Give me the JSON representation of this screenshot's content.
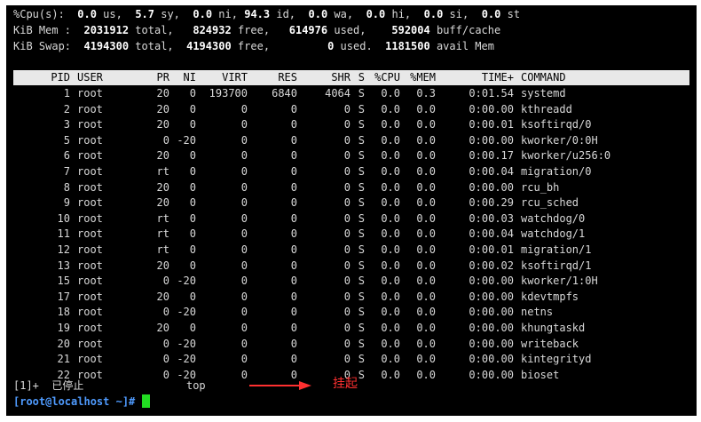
{
  "summary": {
    "cpu": {
      "label": "%Cpu(s):",
      "us": "0.0",
      "us_label": "us,",
      "sy": "5.7",
      "sy_label": "sy,",
      "ni": "0.0",
      "ni_label": "ni,",
      "id": "94.3",
      "id_label": "id,",
      "wa": "0.0",
      "wa_label": "wa,",
      "hi": "0.0",
      "hi_label": "hi,",
      "si": "0.0",
      "si_label": "si,",
      "st": "0.0",
      "st_label": "st"
    },
    "mem": {
      "label": "KiB Mem :",
      "total": "2031912",
      "total_label": "total,",
      "free": "824932",
      "free_label": "free,",
      "used": "614976",
      "used_label": "used,",
      "buff": "592004",
      "buff_label": "buff/cache"
    },
    "swap": {
      "label": "KiB Swap:",
      "total": "4194300",
      "total_label": "total,",
      "free": "4194300",
      "free_label": "free,",
      "used": "0",
      "used_label": "used.",
      "avail": "1181500",
      "avail_label": "avail Mem"
    }
  },
  "table": {
    "columns": [
      "PID",
      "USER",
      "PR",
      "NI",
      "VIRT",
      "RES",
      "SHR",
      "S",
      "%CPU",
      "%MEM",
      "TIME+",
      "COMMAND"
    ],
    "rows": [
      [
        "1",
        "root",
        "20",
        "0",
        "193700",
        "6840",
        "4064",
        "S",
        "0.0",
        "0.3",
        "0:01.54",
        "systemd"
      ],
      [
        "2",
        "root",
        "20",
        "0",
        "0",
        "0",
        "0",
        "S",
        "0.0",
        "0.0",
        "0:00.00",
        "kthreadd"
      ],
      [
        "3",
        "root",
        "20",
        "0",
        "0",
        "0",
        "0",
        "S",
        "0.0",
        "0.0",
        "0:00.01",
        "ksoftirqd/0"
      ],
      [
        "5",
        "root",
        "0",
        "-20",
        "0",
        "0",
        "0",
        "S",
        "0.0",
        "0.0",
        "0:00.00",
        "kworker/0:0H"
      ],
      [
        "6",
        "root",
        "20",
        "0",
        "0",
        "0",
        "0",
        "S",
        "0.0",
        "0.0",
        "0:00.17",
        "kworker/u256:0"
      ],
      [
        "7",
        "root",
        "rt",
        "0",
        "0",
        "0",
        "0",
        "S",
        "0.0",
        "0.0",
        "0:00.04",
        "migration/0"
      ],
      [
        "8",
        "root",
        "20",
        "0",
        "0",
        "0",
        "0",
        "S",
        "0.0",
        "0.0",
        "0:00.00",
        "rcu_bh"
      ],
      [
        "9",
        "root",
        "20",
        "0",
        "0",
        "0",
        "0",
        "S",
        "0.0",
        "0.0",
        "0:00.29",
        "rcu_sched"
      ],
      [
        "10",
        "root",
        "rt",
        "0",
        "0",
        "0",
        "0",
        "S",
        "0.0",
        "0.0",
        "0:00.03",
        "watchdog/0"
      ],
      [
        "11",
        "root",
        "rt",
        "0",
        "0",
        "0",
        "0",
        "S",
        "0.0",
        "0.0",
        "0:00.04",
        "watchdog/1"
      ],
      [
        "12",
        "root",
        "rt",
        "0",
        "0",
        "0",
        "0",
        "S",
        "0.0",
        "0.0",
        "0:00.01",
        "migration/1"
      ],
      [
        "13",
        "root",
        "20",
        "0",
        "0",
        "0",
        "0",
        "S",
        "0.0",
        "0.0",
        "0:00.02",
        "ksoftirqd/1"
      ],
      [
        "15",
        "root",
        "0",
        "-20",
        "0",
        "0",
        "0",
        "S",
        "0.0",
        "0.0",
        "0:00.00",
        "kworker/1:0H"
      ],
      [
        "17",
        "root",
        "20",
        "0",
        "0",
        "0",
        "0",
        "S",
        "0.0",
        "0.0",
        "0:00.00",
        "kdevtmpfs"
      ],
      [
        "18",
        "root",
        "0",
        "-20",
        "0",
        "0",
        "0",
        "S",
        "0.0",
        "0.0",
        "0:00.00",
        "netns"
      ],
      [
        "19",
        "root",
        "20",
        "0",
        "0",
        "0",
        "0",
        "S",
        "0.0",
        "0.0",
        "0:00.00",
        "khungtaskd"
      ],
      [
        "20",
        "root",
        "0",
        "-20",
        "0",
        "0",
        "0",
        "S",
        "0.0",
        "0.0",
        "0:00.00",
        "writeback"
      ],
      [
        "21",
        "root",
        "0",
        "-20",
        "0",
        "0",
        "0",
        "S",
        "0.0",
        "0.0",
        "0:00.00",
        "kintegrityd"
      ],
      [
        "22",
        "root",
        "0",
        "-20",
        "0",
        "0",
        "0",
        "S",
        "0.0",
        "0.0",
        "0:00.00",
        "bioset"
      ]
    ]
  },
  "job": {
    "id": "[1]+",
    "status": "已停止",
    "command": "top"
  },
  "annotation": {
    "text": "挂起",
    "color": "#ff3030"
  },
  "prompt": {
    "text": "[root@localhost ~]#"
  },
  "colors": {
    "terminal_bg": "#000000",
    "header_bar": "#e8e8e8",
    "prompt": "#4f9bff",
    "cursor": "#22dd22"
  }
}
